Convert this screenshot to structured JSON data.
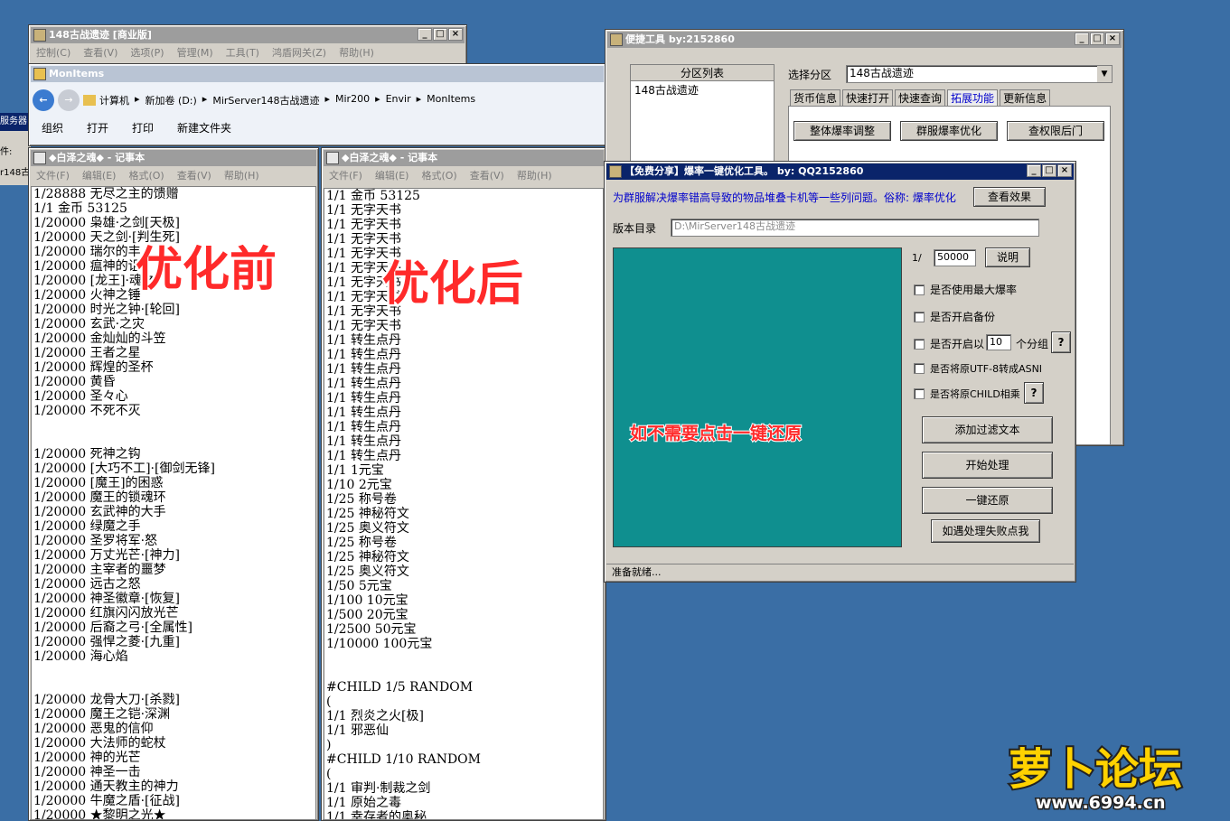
{
  "main_window": {
    "title": "148古战遗迹 [商业版]",
    "menu": [
      "控制(C)",
      "查看(V)",
      "选项(P)",
      "管理(M)",
      "工具(T)",
      "鸿盾网关(Z)",
      "帮助(H)"
    ]
  },
  "explorer": {
    "title": "MonItems",
    "breadcrumb": [
      "计算机",
      "新加卷 (D:)",
      "MirServer148古战遗迹",
      "Mir200",
      "Envir",
      "MonItems"
    ],
    "toolbar": [
      "组织",
      "打开",
      "打印",
      "新建文件夹"
    ]
  },
  "left_edge": {
    "label1": "服务器",
    "label2": "件:",
    "label3": "r148古"
  },
  "notepad_left": {
    "title": "◆白泽之魂◆ - 记事本",
    "menu": [
      "文件(F)",
      "编辑(E)",
      "格式(O)",
      "查看(V)",
      "帮助(H)"
    ],
    "lines": [
      "1/28888 无尽之主的馈赠",
      "1/1 金币 53125",
      "1/20000 枭雄·之剑[天极]",
      "1/20000 天之剑·[判生死]",
      "1/20000 瑞尔的丰",
      "1/20000 瘟神的诅",
      "1/20000 [龙王]·魂之",
      "1/20000 火神之锤",
      "1/20000 时光之钟·[轮回]",
      "1/20000 玄武·之灾",
      "1/20000 金灿灿的斗笠",
      "1/20000 王者之星",
      "1/20000 辉煌的圣杯",
      "1/20000 黄昏",
      "1/20000 圣々心",
      "1/20000 不死不灭",
      "",
      "",
      "1/20000 死神之钩",
      "1/20000 [大巧不工]·[御剑无锋]",
      "1/20000 [魔王]的困惑",
      "1/20000 魔王的锁魂环",
      "1/20000 玄武神的大手",
      "1/20000 绿魔之手",
      "1/20000 圣罗将军·怒",
      "1/20000 万丈光芒·[神力]",
      "1/20000 主宰者的噩梦",
      "1/20000 远古之怒",
      "1/20000 神圣徽章·[恢复]",
      "1/20000 红旗闪闪放光芒",
      "1/20000 后裔之弓·[全属性]",
      "1/20000 强悍之菱·[九重]",
      "1/20000 海心焰",
      "",
      "",
      "1/20000 龙骨大刀·[杀戮]",
      "1/20000 魔王之铠·深渊",
      "1/20000 恶鬼的信仰",
      "1/20000 大法师的蛇杖",
      "1/20000 神的光芒",
      "1/20000 神圣一击",
      "1/20000 通天教主的神力",
      "1/20000 牛魔之盾·[征战]",
      "1/20000 ★黎明之光★"
    ]
  },
  "notepad_right": {
    "title": "◆白泽之魂◆ - 记事本",
    "menu": [
      "文件(F)",
      "编辑(E)",
      "格式(O)",
      "查看(V)",
      "帮助(H)"
    ],
    "lines": [
      "1/1 金币 53125",
      "1/1 无字天书",
      "1/1 无字天书",
      "1/1 无字天书",
      "1/1 无字天书",
      "1/1 无字天书",
      "1/1 无字天书",
      "1/1 无字天书",
      "1/1 无字天书",
      "1/1 无字天书",
      "1/1 转生点丹",
      "1/1 转生点丹",
      "1/1 转生点丹",
      "1/1 转生点丹",
      "1/1 转生点丹",
      "1/1 转生点丹",
      "1/1 转生点丹",
      "1/1 转生点丹",
      "1/1 转生点丹",
      "1/1 1元宝",
      "1/10 2元宝",
      "1/25 称号卷",
      "1/25 神秘符文",
      "1/25 奥义符文",
      "1/25 称号卷",
      "1/25 神秘符文",
      "1/25 奥义符文",
      "1/50 5元宝",
      "1/100 10元宝",
      "1/500 20元宝",
      "1/2500 50元宝",
      "1/10000 100元宝",
      "",
      "",
      "#CHILD 1/5 RANDOM",
      "(",
      "1/1 烈炎之火[极]",
      "1/1 邪恶仙",
      ")",
      "#CHILD 1/10 RANDOM",
      "(",
      "1/1 审判·制裁之剑",
      "1/1 原始之毒",
      "1/1 幸存者的奥秘"
    ]
  },
  "tools_window": {
    "title": "便捷工具  by:2152860",
    "list_header": "分区列表",
    "list_item": "148古战遗迹",
    "select_label": "选择分区",
    "select_value": "148古战遗迹",
    "tabs": [
      "货币信息",
      "快速打开",
      "快速查询",
      "拓展功能",
      "更新信息"
    ],
    "buttons": [
      "整体爆率调整",
      "群服爆率优化",
      "查权限后门"
    ]
  },
  "optimizer": {
    "title": "【免费分享】爆率一键优化工具。  by: QQ2152860",
    "description": "为群服解决爆率错高导致的物品堆叠卡机等一些列问题。俗称: 爆率优化",
    "view_effect": "查看效果",
    "version_label": "版本目录",
    "version_path": "D:\\MirServer148古战遗迹",
    "ratio_prefix": "1/",
    "ratio_value": "50000",
    "explain": "说明",
    "options": [
      "是否使用最大爆率",
      "是否开启备份"
    ],
    "group_label_pre": "是否开启以",
    "group_value": "10",
    "group_label_post": "个分组",
    "utf_option": "是否将原UTF-8转成ASNI",
    "child_option": "是否将原CHILD相乘",
    "question": "?",
    "overlay_text": "如不需要点击一键还原",
    "actions": [
      "添加过滤文本",
      "开始处理",
      "一键还原",
      "如遇处理失败点我"
    ],
    "status": "准备就绪..."
  },
  "annotations": {
    "before": "优化前",
    "after": "优化后"
  },
  "watermark": {
    "brand": "萝卜论坛",
    "url": "www.6994.cn"
  },
  "colors": {
    "teal": "#0f8f8f",
    "title_active": "#0a246a",
    "title_inactive": "#9d9d9d",
    "overlay_red": "#ff2a2a"
  }
}
